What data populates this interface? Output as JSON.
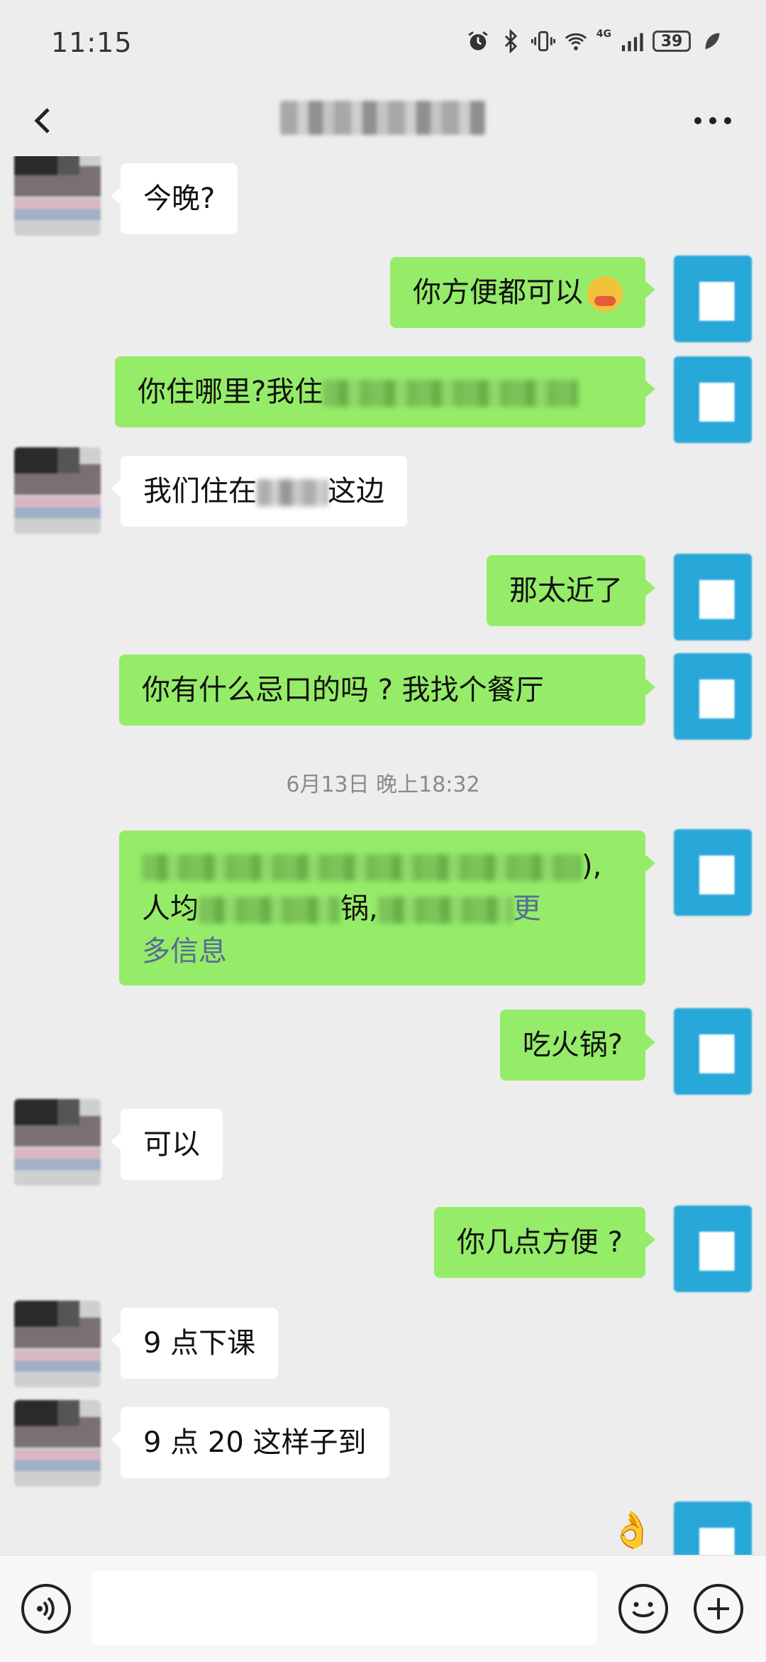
{
  "status_bar": {
    "time": "11:15",
    "battery": "39",
    "network": "4G",
    "icons": [
      "alarm-icon",
      "bluetooth-icon",
      "vibrate-icon",
      "wifi-icon",
      "signal-icon",
      "battery-icon",
      "leaf-icon"
    ]
  },
  "header": {
    "back_icon": "chevron-left-icon",
    "more_icon": "more-dots-icon"
  },
  "chat": {
    "timestamp": "6月13日 晚上18:32",
    "messages": [
      {
        "side": "in",
        "text": "今晚?"
      },
      {
        "side": "out",
        "text": "你方便都可以"
      },
      {
        "side": "out",
        "text_prefix": "你住哪里?我住"
      },
      {
        "side": "in",
        "text_prefix": "我们住在",
        "text_suffix": "这边"
      },
      {
        "side": "out",
        "text": "那太近了"
      },
      {
        "side": "out",
        "text": "你有什么忌口的吗 ? 我找个餐厅"
      },
      {
        "side": "out",
        "line1_end": "),",
        "line2_start": "人均",
        "line2_mid": "锅,",
        "link_part1": "更",
        "link_part2": "多信息"
      },
      {
        "side": "out",
        "text": "吃火锅?"
      },
      {
        "side": "in",
        "text": "可以"
      },
      {
        "side": "out",
        "text": "你几点方便 ?"
      },
      {
        "side": "in",
        "text": "9 点下课"
      },
      {
        "side": "in",
        "text": "9 点 20 这样子到"
      }
    ]
  },
  "input_bar": {
    "voice_icon": "voice-icon",
    "emoji_icon": "emoji-icon",
    "plus_icon": "plus-icon"
  },
  "colors": {
    "background": "#ededed",
    "bubble_in": "#ffffff",
    "bubble_out": "#95ec69",
    "link": "#576b95",
    "avatar_self": "#28a7d9"
  }
}
